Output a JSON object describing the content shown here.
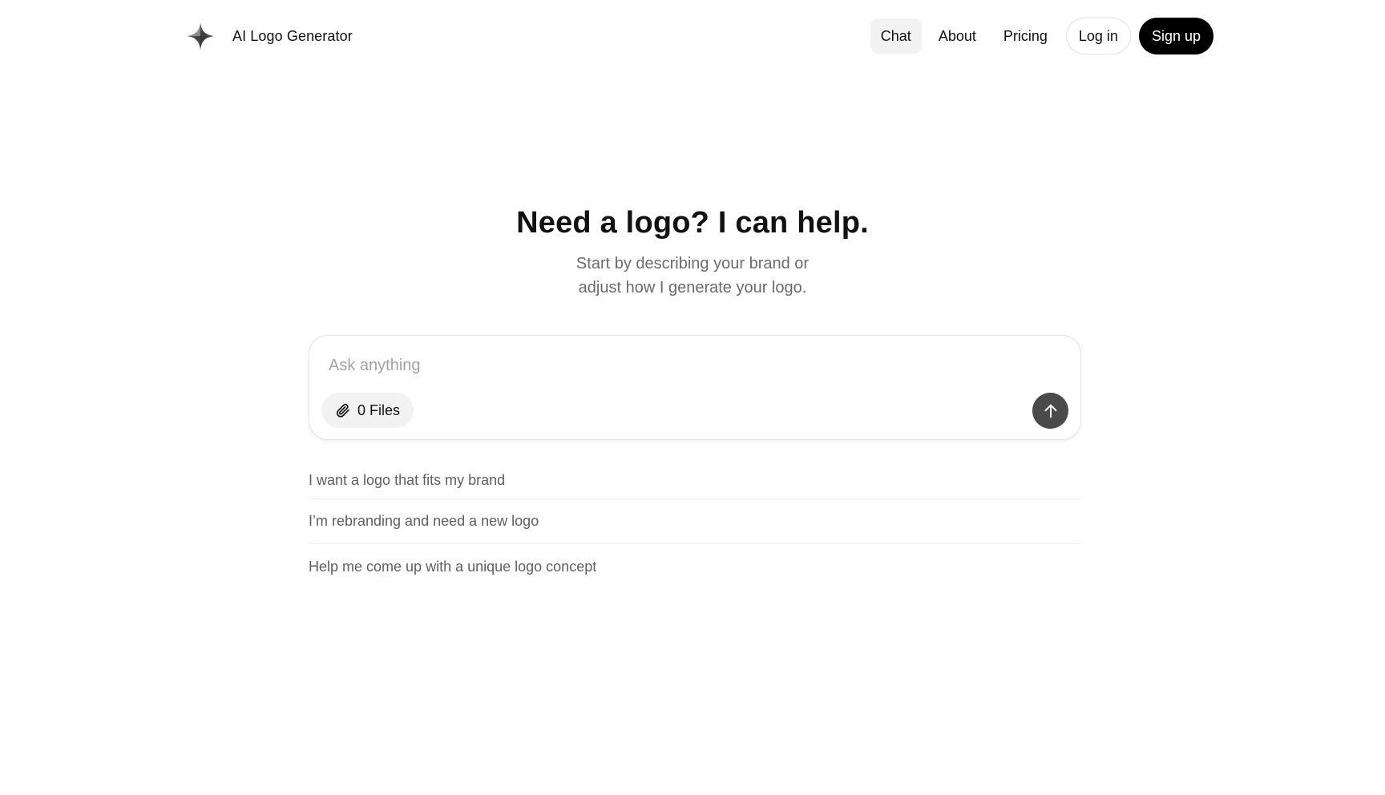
{
  "header": {
    "brand_name": "AI Logo Generator",
    "brand_icon": "sparkle-star-icon",
    "nav": [
      {
        "label": "Chat",
        "active": true
      },
      {
        "label": "About",
        "active": false
      },
      {
        "label": "Pricing",
        "active": false
      }
    ],
    "login_label": "Log in",
    "signup_label": "Sign up"
  },
  "hero": {
    "title": "Need a logo? I can help.",
    "subtitle_line1": "Start by describing your brand or",
    "subtitle_line2": "adjust how I generate your logo."
  },
  "composer": {
    "placeholder": "Ask anything",
    "value": "",
    "files_label": "0 Files",
    "files_icon": "paperclip-icon",
    "send_icon": "arrow-up-icon"
  },
  "suggestions": [
    "I want a logo that fits my brand",
    "I’m rebranding and need a new logo",
    "Help me come up with a unique logo concept"
  ],
  "colors": {
    "primary_button": "#000000",
    "send_button": "#4a4a4a",
    "active_nav_bg": "#f2f2f2",
    "muted_text": "#6b6b6b"
  }
}
